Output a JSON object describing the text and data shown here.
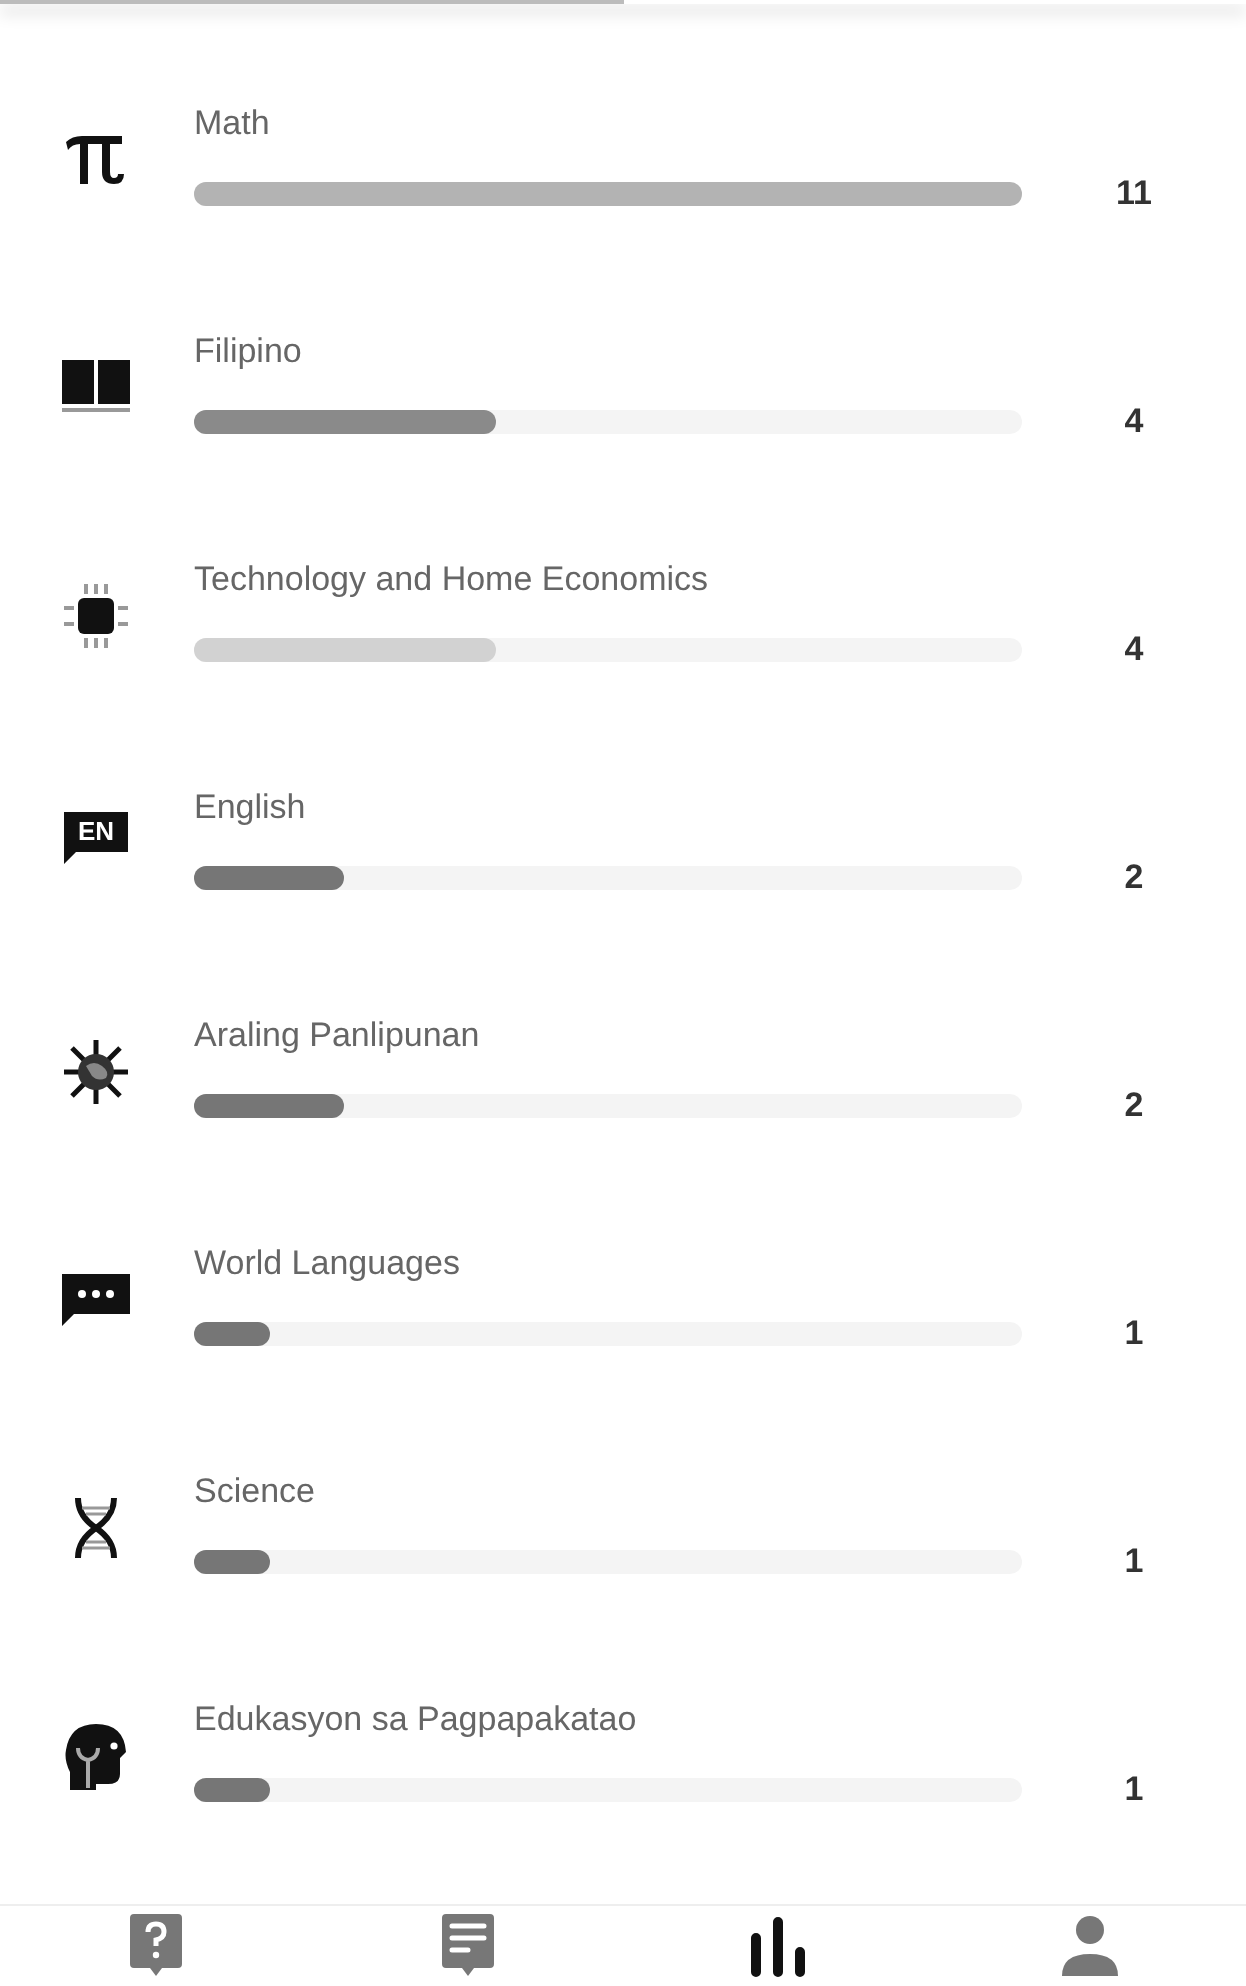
{
  "top_progress": {
    "level": 0.5
  },
  "subjects": [
    {
      "name": "Math",
      "count": "11",
      "level": 1.0,
      "color": "#b3b3b3"
    },
    {
      "name": "Filipino",
      "count": "4",
      "level": 0.365,
      "color": "#8a8a8a"
    },
    {
      "name": "Technology and Home Economics",
      "count": "4",
      "level": 0.365,
      "color": "#d2d2d2"
    },
    {
      "name": "English",
      "count": "2",
      "level": 0.182,
      "color": "#767676",
      "icon_text": "EN"
    },
    {
      "name": "Araling Panlipunan",
      "count": "2",
      "level": 0.182,
      "color": "#767676"
    },
    {
      "name": "World Languages",
      "count": "1",
      "level": 0.091,
      "color": "#767676"
    },
    {
      "name": "Science",
      "count": "1",
      "level": 0.091,
      "color": "#767676"
    },
    {
      "name": "Edukasyon sa Pagpapakatao",
      "count": "1",
      "level": 0.091,
      "color": "#767676"
    }
  ],
  "nav": [
    {
      "selected": false
    },
    {
      "selected": false
    },
    {
      "selected": true
    },
    {
      "selected": false
    }
  ]
}
